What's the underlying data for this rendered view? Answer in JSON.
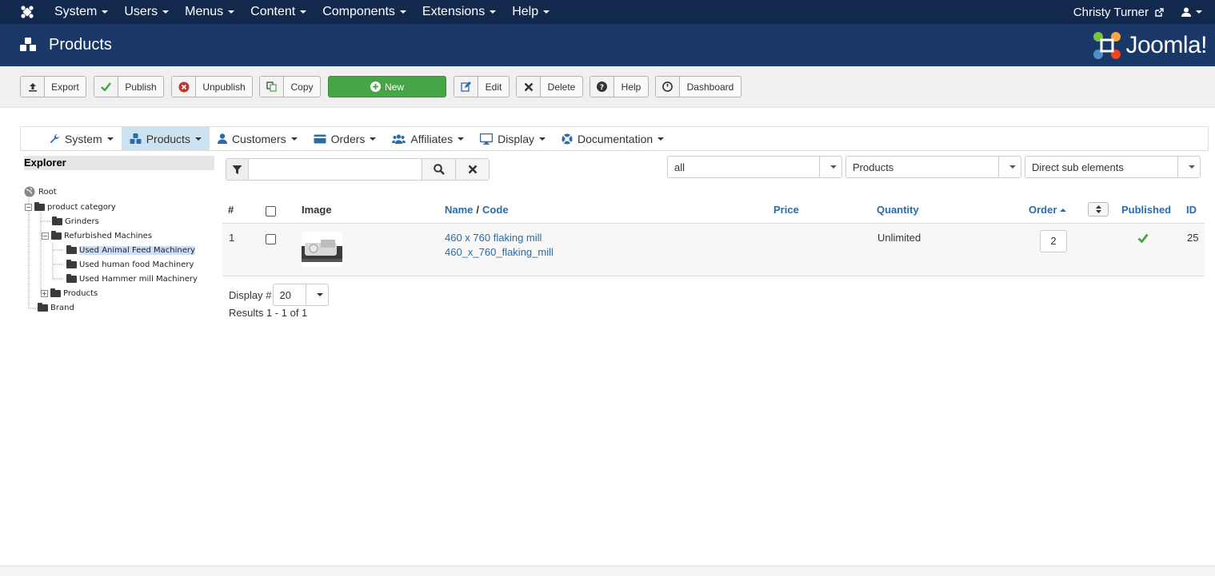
{
  "topnav": {
    "menu": [
      "System",
      "Users",
      "Menus",
      "Content",
      "Components",
      "Extensions",
      "Help"
    ],
    "user": "Christy Turner"
  },
  "header": {
    "title": "Products",
    "brand": "Joomla!"
  },
  "toolbar": {
    "export": "Export",
    "publish": "Publish",
    "unpublish": "Unpublish",
    "copy": "Copy",
    "new": "New",
    "edit": "Edit",
    "delete": "Delete",
    "help": "Help",
    "dashboard": "Dashboard"
  },
  "subnav": [
    "System",
    "Products",
    "Customers",
    "Orders",
    "Affiliates",
    "Display",
    "Documentation"
  ],
  "explorer": {
    "title": "Explorer",
    "nodes": [
      "Root",
      "product category",
      "Grinders",
      "Refurbished Machines",
      "Used Animal Feed Machinery",
      "Used human food Machinery",
      "Used Hammer mill Machinery",
      "Products",
      "Brand"
    ]
  },
  "search": {
    "value": ""
  },
  "filters": {
    "status": "all",
    "type": "Products",
    "level": "Direct sub elements"
  },
  "table": {
    "headers": {
      "num": "#",
      "image": "Image",
      "name": "Name",
      "sep": "/",
      "code": "Code",
      "price": "Price",
      "quantity": "Quantity",
      "order": "Order",
      "published": "Published",
      "id": "ID"
    },
    "rows": [
      {
        "num": "1",
        "name": "460 x 760 flaking mill",
        "code": "460_x_760_flaking_mill",
        "price": "",
        "quantity": "Unlimited",
        "order": "2",
        "id": "25"
      }
    ]
  },
  "pager": {
    "label": "Display #",
    "value": "20",
    "results": "Results 1 - 1 of 1"
  },
  "colors": {
    "topnav": "#12294d",
    "header": "#1a3867",
    "link": "#2a6ca8",
    "green": "#46a546"
  }
}
